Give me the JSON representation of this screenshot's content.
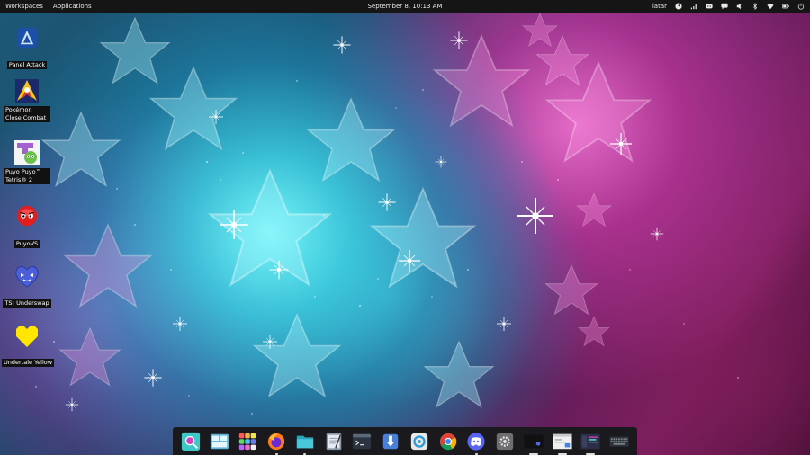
{
  "topbar": {
    "workspaces": "Workspaces",
    "applications": "Applications",
    "clock": "September 8, 10:13 AM",
    "user": "latar",
    "tray_icons": [
      "steam-icon",
      "network-icon",
      "discord-icon",
      "chat-icon",
      "volume-icon",
      "bluetooth-icon",
      "wifi-icon",
      "battery-icon",
      "power-icon"
    ]
  },
  "desktop": {
    "icons": [
      {
        "label": "Panel Attack"
      },
      {
        "label": "Pokémon Close Combat"
      },
      {
        "label": "Puyo Puyo™ Tetris® 2"
      },
      {
        "label": "PuyoVS"
      },
      {
        "label": "TS! Underswap"
      },
      {
        "label": "Undertale Yellow"
      }
    ]
  },
  "dock": {
    "items": [
      "search-launcher-icon",
      "multitasking-icon",
      "app-grid-icon",
      "firefox-icon",
      "files-icon",
      "text-editor-icon",
      "terminal-icon",
      "downloader-icon",
      "app-center-icon",
      "chrome-icon",
      "discord-icon",
      "settings-icon",
      "window-thumb-1",
      "window-thumb-2",
      "window-thumb-3",
      "keyboard-thumb"
    ]
  },
  "colors": {
    "topbar_bg": "#151515",
    "dock_bg": "#1a1a1e",
    "accent_cyan": "#5fe3ef",
    "accent_pink": "#e05ec0"
  }
}
